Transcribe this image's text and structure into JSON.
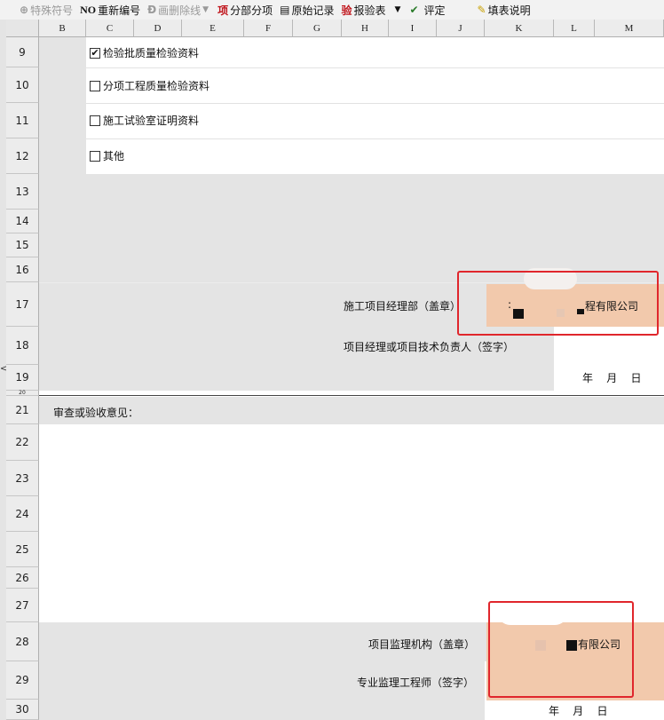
{
  "toolbar": {
    "special_char": "特殊符号",
    "renumber": "重新编号",
    "strikethrough": "画删除线",
    "split_items": "分部分项",
    "raw_record": "原始记录",
    "report_inspection": "报验表",
    "evaluate": "评定",
    "fill_instructions": "填表说明",
    "icon_no": "NO",
    "icon_xiang": "项",
    "icon_yan": "验"
  },
  "columns": [
    "B",
    "C",
    "D",
    "E",
    "F",
    "G",
    "H",
    "I",
    "J",
    "K",
    "L",
    "M"
  ],
  "rows": [
    "9",
    "10",
    "11",
    "12",
    "13",
    "14",
    "15",
    "16",
    "17",
    "18",
    "19",
    "20",
    "21",
    "22",
    "23",
    "24",
    "25",
    "26",
    "27",
    "28",
    "29",
    "30"
  ],
  "checklist": [
    {
      "label": "检验批质量检验资料",
      "checked": true
    },
    {
      "label": "分项工程质量检验资料",
      "checked": false
    },
    {
      "label": "施工试验室证明资料",
      "checked": false
    },
    {
      "label": "其他",
      "checked": false
    }
  ],
  "contractor": {
    "dept_label": "施工项目经理部（盖章）",
    "stamp_text": "程有限公司",
    "manager_label": "项目经理或项目技术负责人（签字）",
    "date": "年    月    日"
  },
  "review": {
    "label": "审查或验收意见："
  },
  "supervisor": {
    "org_label": "项目监理机构（盖章）",
    "stamp_text": "有限公司",
    "engineer_label": "专业监理工程师（签字）",
    "date": "年    月    日"
  },
  "colors": {
    "grey_fill": "#e4e4e4",
    "stamp_fill": "#f2c9ac",
    "highlight_border": "#e0262c"
  }
}
